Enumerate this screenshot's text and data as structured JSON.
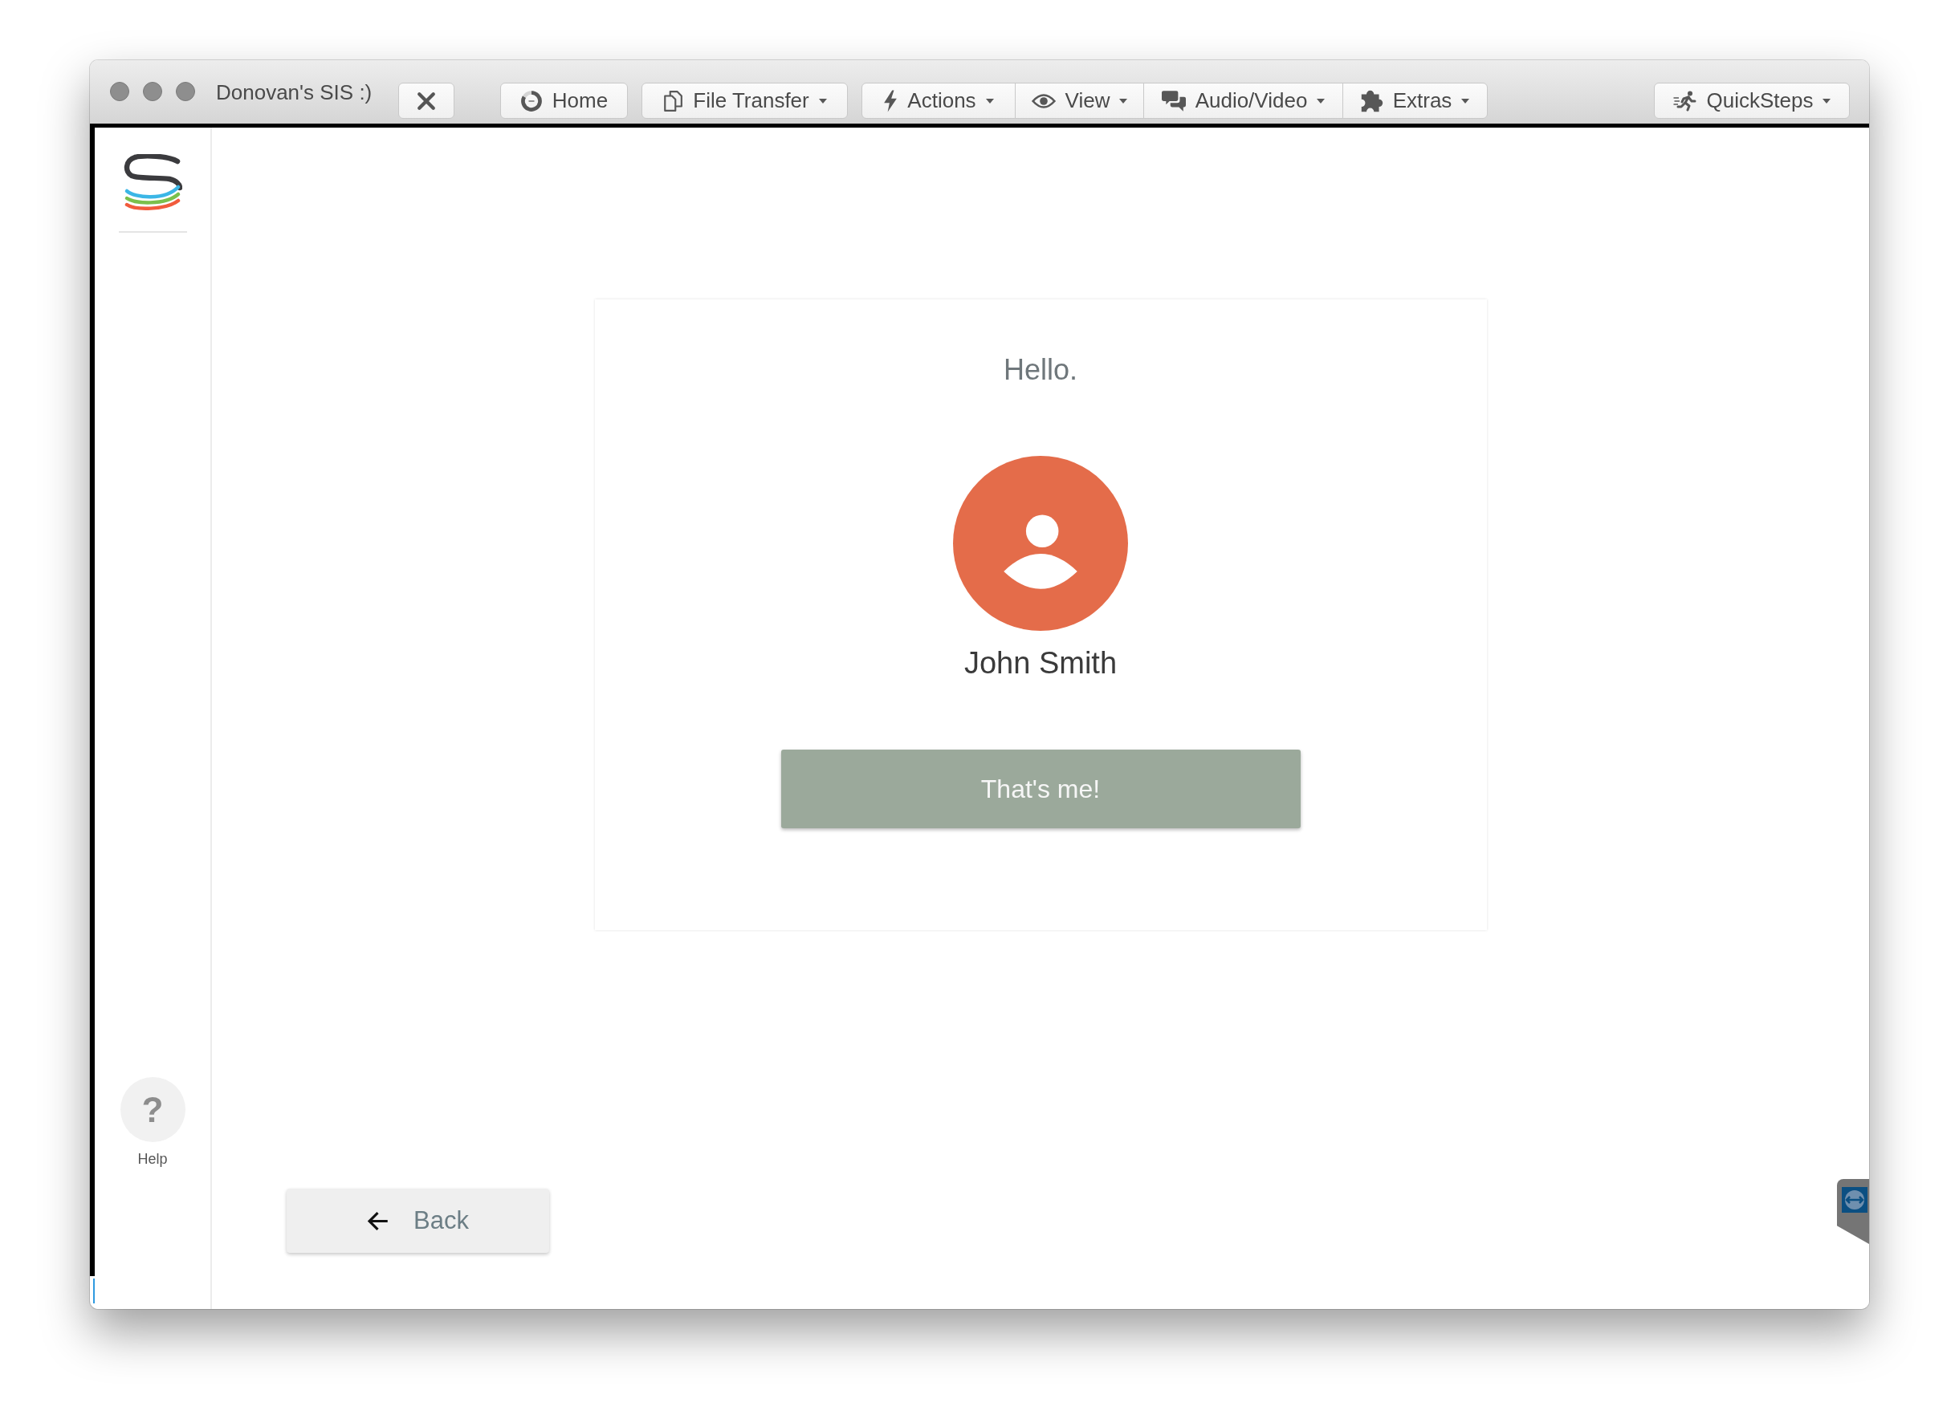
{
  "window": {
    "title": "Donovan's SIS :)"
  },
  "toolbar": {
    "button_groups": [
      {
        "buttons": [
          {
            "label": "Home",
            "dropdown": false
          }
        ]
      },
      {
        "buttons": [
          {
            "label": "File Transfer",
            "dropdown": true
          }
        ]
      },
      {
        "buttons": [
          {
            "label": "Actions",
            "dropdown": true
          },
          {
            "label": "View",
            "dropdown": true
          },
          {
            "label": "Audio/Video",
            "dropdown": true
          },
          {
            "label": "Extras",
            "dropdown": true
          }
        ]
      }
    ],
    "right_buttons": [
      {
        "label": "QuickSteps",
        "dropdown": true
      }
    ]
  },
  "sidebar": {
    "help_button": "?",
    "help_label": "Help"
  },
  "card": {
    "greeting": "Hello.",
    "name": "John Smith",
    "confirm_button": "That's me!"
  },
  "back_button": "Back"
}
